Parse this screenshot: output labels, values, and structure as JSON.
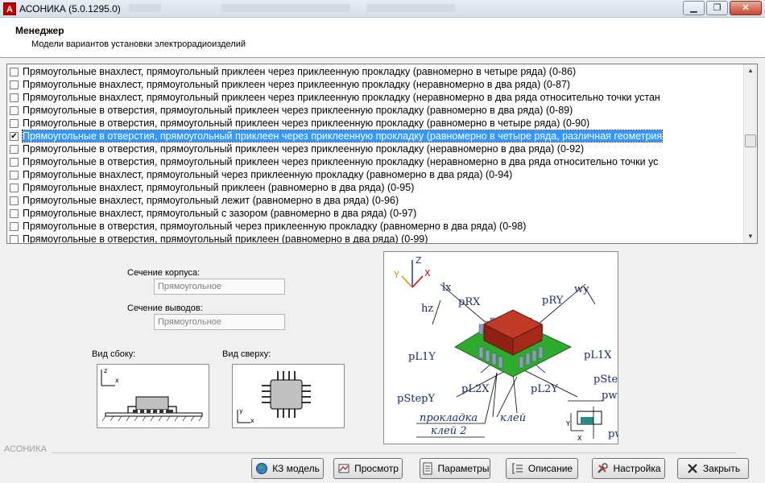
{
  "window": {
    "title": "АСОНИКА (5.0.1295.0)",
    "app_icon": "А"
  },
  "header": {
    "title": "Менеджер",
    "subtitle": "Модели вариантов установки электрорадиоизделий"
  },
  "list": {
    "items": [
      {
        "label": "Прямоугольные внахлест, прямоугольный приклеен через приклеенную прокладку (равномерно в четыре ряда) (0-86)",
        "checked": false,
        "selected": false
      },
      {
        "label": "Прямоугольные внахлест, прямоугольный приклеен через приклеенную прокладку (неравномерно в два ряда) (0-87)",
        "checked": false,
        "selected": false
      },
      {
        "label": "Прямоугольные внахлест, прямоугольный приклеен через приклеенную прокладку (неравномерно в два ряда относительно точки устан",
        "checked": false,
        "selected": false
      },
      {
        "label": "Прямоугольные в отверстия, прямоугольный приклеен через приклеенную прокладку (равномерно в два ряда) (0-89)",
        "checked": false,
        "selected": false
      },
      {
        "label": "Прямоугольные в отверстия, прямоугольный приклеен через приклеенную прокладку (равномерно в четыре ряда) (0-90)",
        "checked": false,
        "selected": false
      },
      {
        "label": "Прямоугольные в отверстия, прямоугольный приклеен через приклеенную прокладку (равномерно в четыре ряда, различная геометрия",
        "checked": true,
        "selected": true
      },
      {
        "label": "Прямоугольные в отверстия, прямоугольный приклеен через приклеенную прокладку (неравномерно в два ряда) (0-92)",
        "checked": false,
        "selected": false
      },
      {
        "label": "Прямоугольные в отверстия, прямоугольный приклеен через приклеенную прокладку (неравномерно в два ряда относительно точки ус",
        "checked": false,
        "selected": false
      },
      {
        "label": "Прямоугольные внахлест, прямоугольный через приклеенную прокладку (равномерно в два ряда) (0-94)",
        "checked": false,
        "selected": false
      },
      {
        "label": "Прямоугольные внахлест, прямоугольный приклеен (равномерно в два ряда) (0-95)",
        "checked": false,
        "selected": false
      },
      {
        "label": "Прямоугольные внахлест, прямоугольный лежит (равномерно в два ряда) (0-96)",
        "checked": false,
        "selected": false
      },
      {
        "label": "Прямоугольные внахлест, прямоугольный с зазором (равномерно в два ряда) (0-97)",
        "checked": false,
        "selected": false
      },
      {
        "label": "Прямоугольные в отверстия, прямоугольный через приклеенную прокладку (равномерно в два ряда) (0-98)",
        "checked": false,
        "selected": false
      },
      {
        "label": "Прямоугольные в отверстия, прямоугольный приклеен (равномерно в два ряда) (0-99)",
        "checked": false,
        "selected": false
      }
    ]
  },
  "form": {
    "body_section_label": "Сечение корпуса:",
    "body_section_value": "Прямоугольное",
    "leads_section_label": "Сечение выводов:",
    "leads_section_value": "Прямоугольное",
    "side_view_label": "Вид сбоку:",
    "top_view_label": "Вид сверху:"
  },
  "side_view": {
    "axis_z": "z",
    "axis_x": "x"
  },
  "top_view": {
    "axis_y": "y",
    "axis_x": "x"
  },
  "diagram": {
    "axis_z": "Z",
    "axis_x": "X",
    "axis_y": "Y",
    "labels": {
      "lx": "lx",
      "wy": "wy",
      "hz": "hz",
      "prx": "pRX",
      "pry": "pRY",
      "pl1y": "pL1Y",
      "pl1x": "pL1X",
      "pstepx": "pStepX",
      "pstepy": "pStepY",
      "pl2x": "pL2X",
      "pl2y": "pL2Y",
      "pwx": "pwx",
      "pwy": "pwy",
      "pad": "прокладка",
      "glue": "клей",
      "glue2": "клей 2",
      "mini_y": "Y",
      "mini_x": "X"
    },
    "colors": {
      "body": "#a52a1a",
      "board": "#2eaa2e",
      "leads": "#8aa0b8",
      "pad_teal": "#2a8a8a"
    }
  },
  "footer": {
    "brand": "АСОНИКА"
  },
  "buttons": {
    "kz_model": "КЗ модель",
    "preview": "Просмотр",
    "params": "Параметры",
    "description": "Описание",
    "settings": "Настройка",
    "close": "Закрыть"
  }
}
